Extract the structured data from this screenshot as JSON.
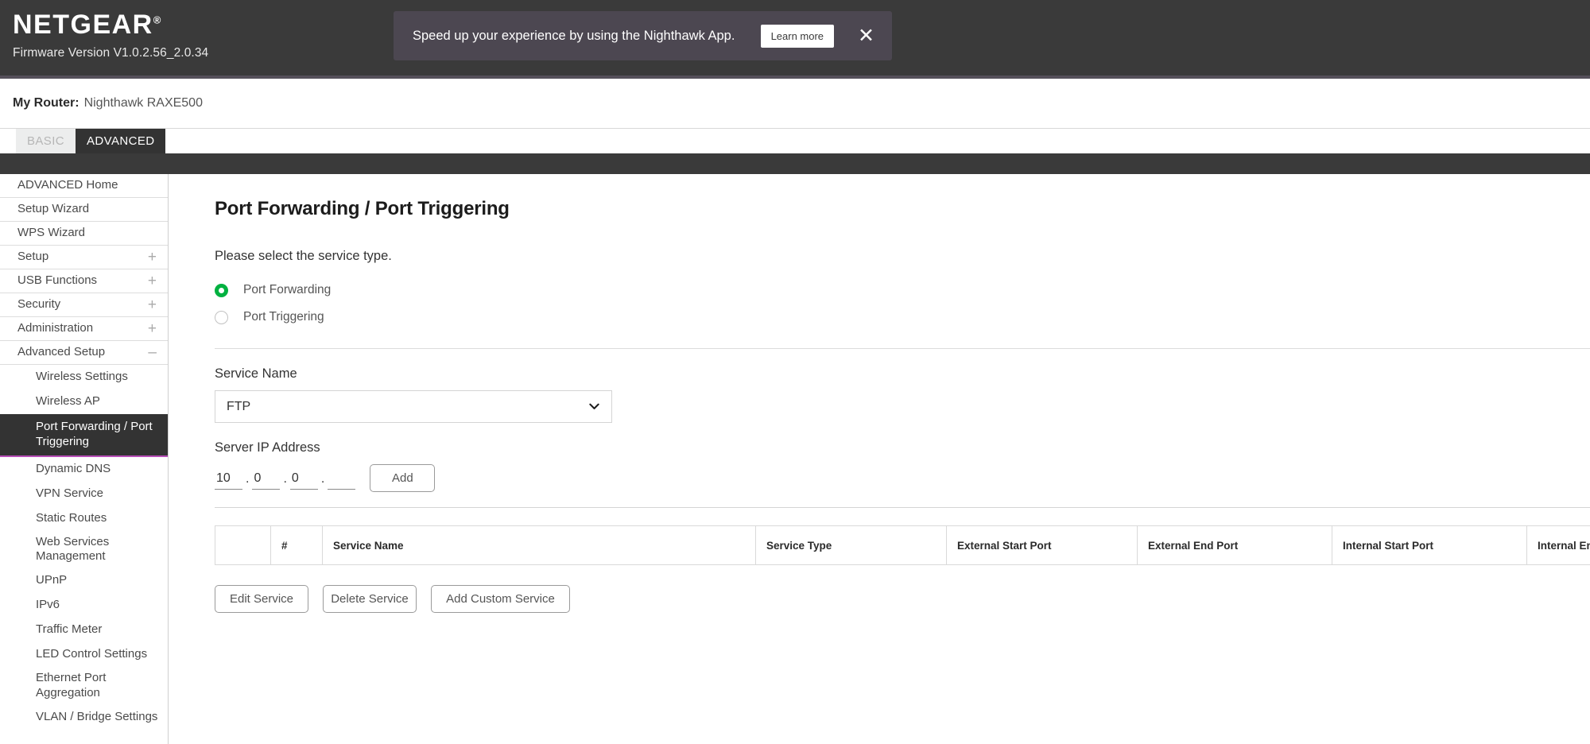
{
  "header": {
    "brand": "NETGEAR",
    "brand_registered": "®",
    "firmware": "Firmware Version V1.0.2.56_2.0.34",
    "bg_color": "#3a3a3a"
  },
  "promo": {
    "message": "Speed up your experience by using the Nighthawk App.",
    "button_label": "Learn more",
    "close_icon": "close-icon",
    "bg_color": "#4c4751"
  },
  "router_bar": {
    "label": "My Router:",
    "value": "Nighthawk RAXE500"
  },
  "tabs": [
    {
      "label": "BASIC",
      "active": false
    },
    {
      "label": "ADVANCED",
      "active": true
    }
  ],
  "sidebar": {
    "items": [
      {
        "label": "ADVANCED Home",
        "expander": "",
        "level": "top",
        "active": false
      },
      {
        "label": "Setup Wizard",
        "expander": "",
        "level": "top",
        "active": false
      },
      {
        "label": "WPS Wizard",
        "expander": "",
        "level": "top",
        "active": false
      },
      {
        "label": "Setup",
        "expander": "+",
        "level": "top",
        "active": false
      },
      {
        "label": "USB Functions",
        "expander": "+",
        "level": "top",
        "active": false
      },
      {
        "label": "Security",
        "expander": "+",
        "level": "top",
        "active": false
      },
      {
        "label": "Administration",
        "expander": "+",
        "level": "top",
        "active": false
      },
      {
        "label": "Advanced Setup",
        "expander": "–",
        "level": "top",
        "active": false
      },
      {
        "label": "Wireless Settings",
        "expander": "",
        "level": "sub",
        "active": false
      },
      {
        "label": "Wireless AP",
        "expander": "",
        "level": "sub",
        "active": false
      },
      {
        "label": "Port Forwarding / Port Triggering",
        "expander": "",
        "level": "sub",
        "active": true
      },
      {
        "label": "Dynamic DNS",
        "expander": "",
        "level": "sub",
        "active": false
      },
      {
        "label": "VPN Service",
        "expander": "",
        "level": "sub",
        "active": false
      },
      {
        "label": "Static Routes",
        "expander": "",
        "level": "sub",
        "active": false
      },
      {
        "label": "Web Services Management",
        "expander": "",
        "level": "sub",
        "active": false
      },
      {
        "label": "UPnP",
        "expander": "",
        "level": "sub",
        "active": false
      },
      {
        "label": "IPv6",
        "expander": "",
        "level": "sub",
        "active": false
      },
      {
        "label": "Traffic Meter",
        "expander": "",
        "level": "sub",
        "active": false
      },
      {
        "label": "LED Control Settings",
        "expander": "",
        "level": "sub",
        "active": false
      },
      {
        "label": "Ethernet Port Aggregation",
        "expander": "",
        "level": "sub",
        "active": false
      },
      {
        "label": "VLAN / Bridge Settings",
        "expander": "",
        "level": "sub",
        "active": false
      }
    ],
    "active_accent_color": "#b84fb8",
    "active_bg_color": "#333333"
  },
  "main": {
    "page_title": "Port Forwarding / Port Triggering",
    "service_type_prompt": "Please select the service type.",
    "service_type_options": [
      {
        "label": "Port Forwarding",
        "selected": true
      },
      {
        "label": "Port Triggering",
        "selected": false
      }
    ],
    "radio_selected_color": "#00b140",
    "service_name": {
      "label": "Service Name",
      "value": "FTP",
      "chevron_icon": "chevron-down-icon"
    },
    "server_ip": {
      "label": "Server IP Address",
      "octets": [
        "10",
        "0",
        "0",
        ""
      ],
      "separator": ".",
      "add_button_label": "Add"
    },
    "table": {
      "columns": [
        "",
        "#",
        "Service Name",
        "Service Type",
        "External Start Port",
        "External End Port",
        "Internal Start Port",
        "Internal End Port"
      ],
      "rows": []
    },
    "actions": [
      {
        "label": "Edit Service"
      },
      {
        "label": "Delete Service"
      },
      {
        "label": "Add Custom Service"
      }
    ]
  }
}
